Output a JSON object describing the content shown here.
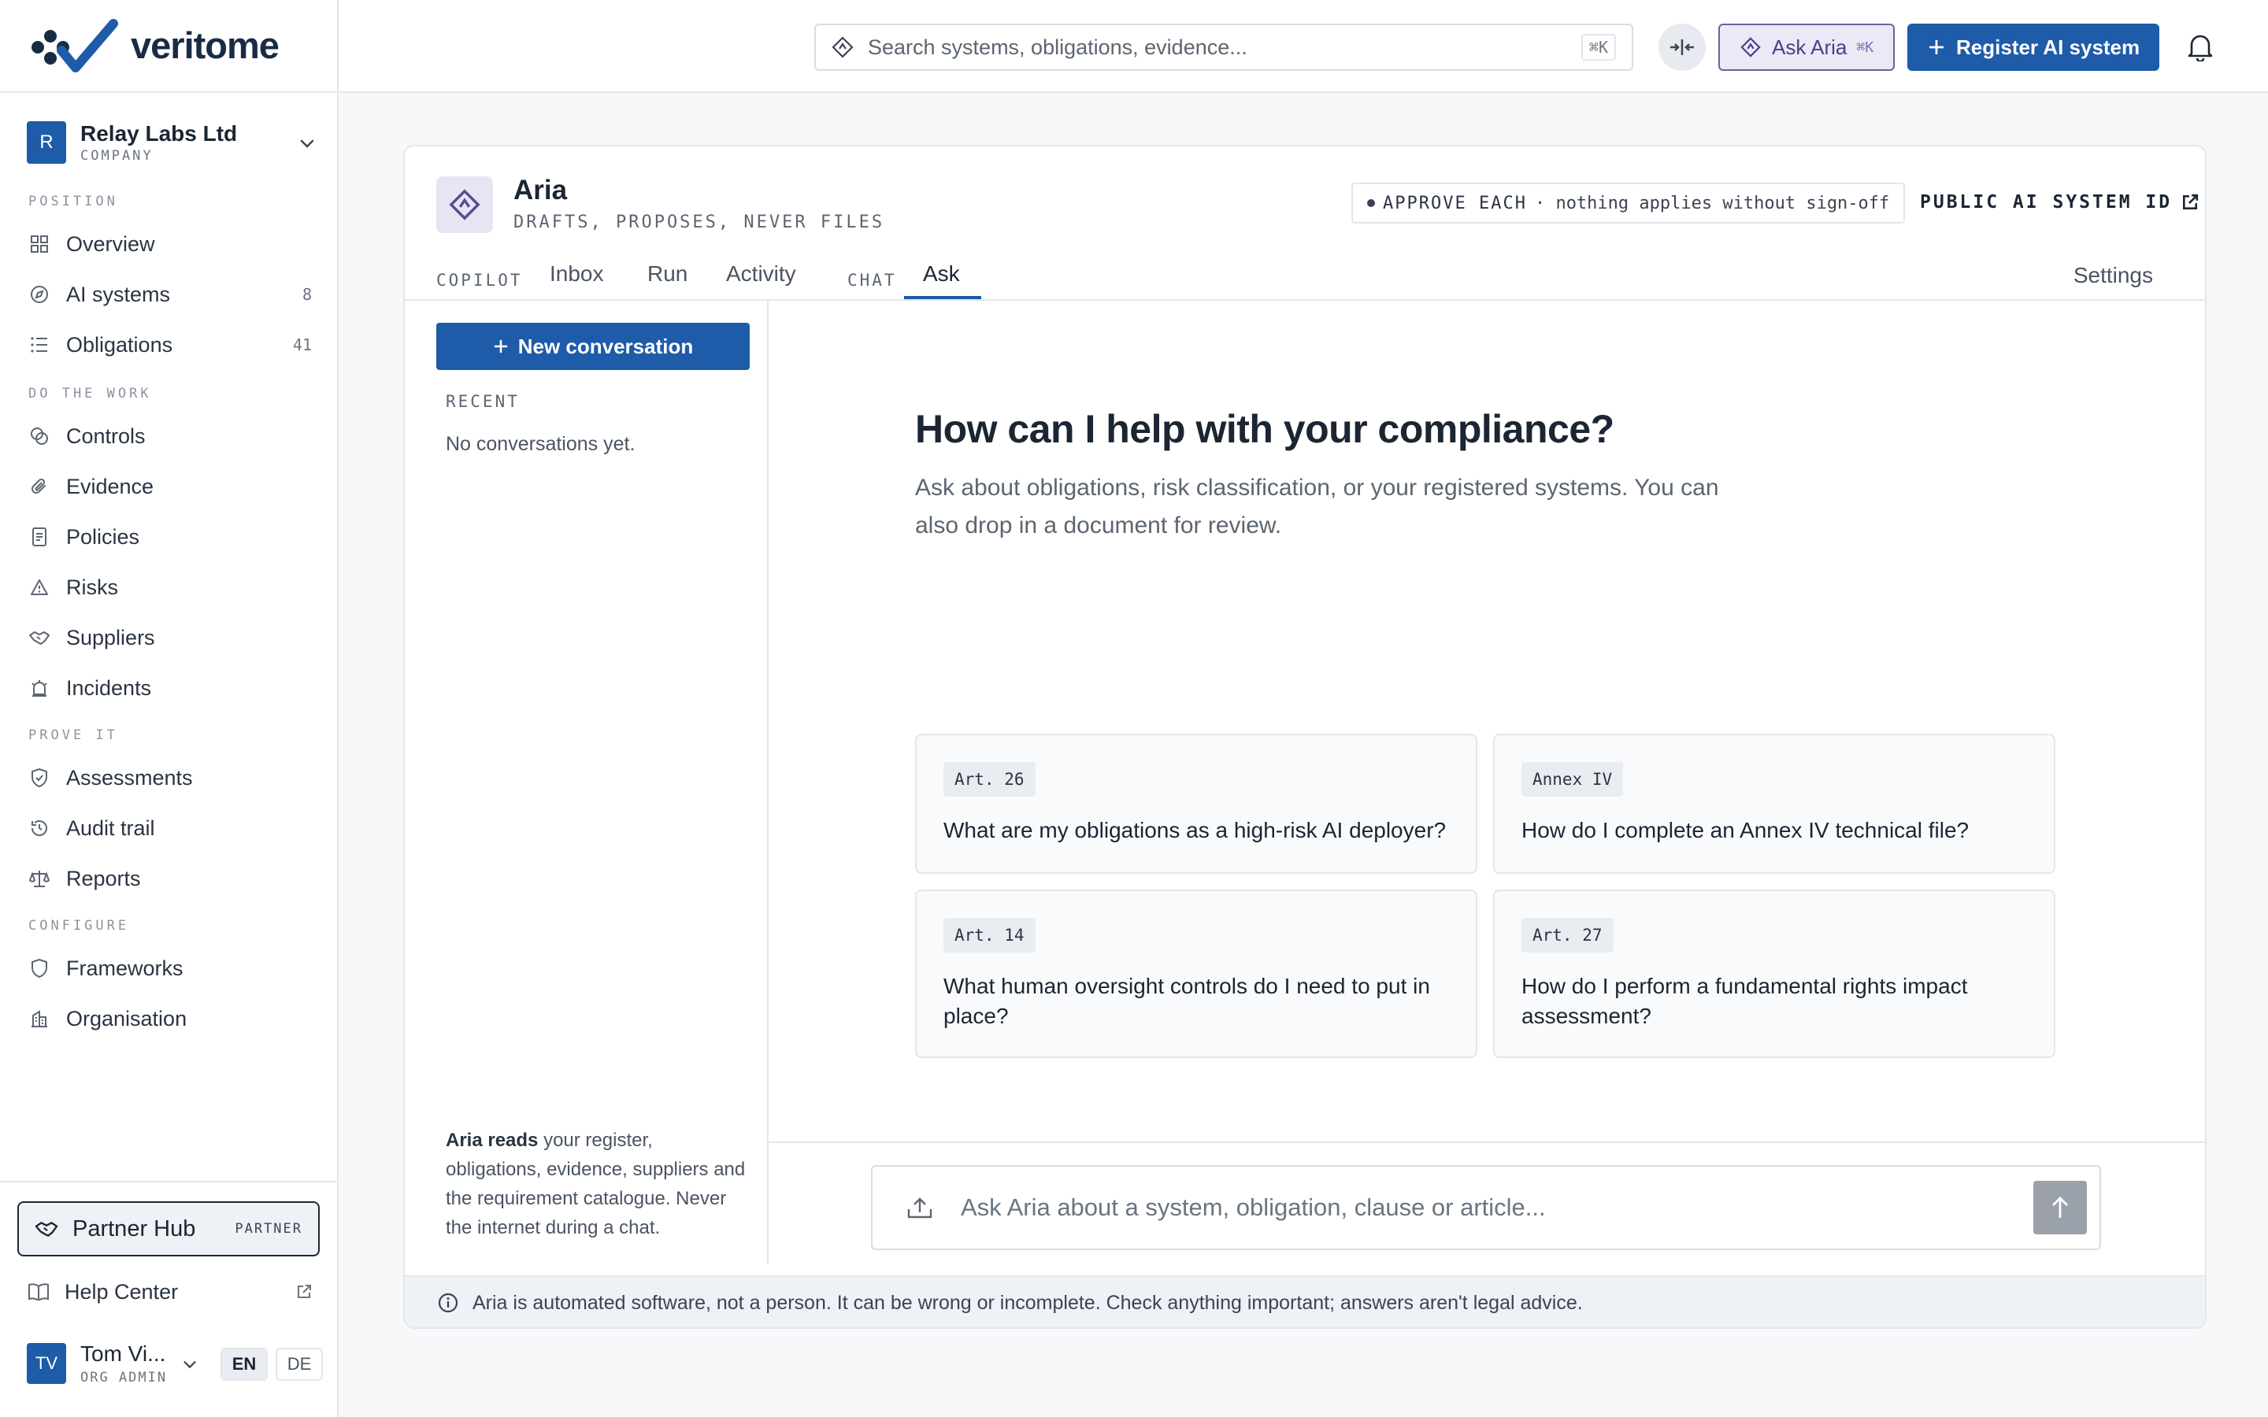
{
  "brand": {
    "name": "veritome"
  },
  "org": {
    "avatar": "R",
    "name": "Relay Labs Ltd",
    "role": "COMPANY"
  },
  "nav": {
    "sections": {
      "position": "POSITION",
      "do_the_work": "DO THE WORK",
      "prove_it": "PROVE IT",
      "configure": "CONFIGURE"
    },
    "items": [
      {
        "label": "Overview",
        "icon": "grid-icon"
      },
      {
        "label": "AI systems",
        "icon": "compass-icon",
        "count": "8"
      },
      {
        "label": "Obligations",
        "icon": "list-icon",
        "count": "41"
      },
      {
        "label": "Controls",
        "icon": "controls-icon"
      },
      {
        "label": "Evidence",
        "icon": "paperclip-icon"
      },
      {
        "label": "Policies",
        "icon": "document-icon"
      },
      {
        "label": "Risks",
        "icon": "warning-icon"
      },
      {
        "label": "Suppliers",
        "icon": "handshake-icon"
      },
      {
        "label": "Incidents",
        "icon": "alarm-icon"
      },
      {
        "label": "Assessments",
        "icon": "shield-check-icon"
      },
      {
        "label": "Audit trail",
        "icon": "history-icon"
      },
      {
        "label": "Reports",
        "icon": "scale-icon"
      },
      {
        "label": "Frameworks",
        "icon": "shield-icon"
      },
      {
        "label": "Organisation",
        "icon": "building-icon"
      }
    ]
  },
  "partner_hub": {
    "label": "Partner Hub",
    "badge": "PARTNER"
  },
  "help_center": {
    "label": "Help Center"
  },
  "user": {
    "initials": "TV",
    "name": "Tom Vi...",
    "role": "ORG ADMIN"
  },
  "languages": [
    "EN",
    "DE"
  ],
  "topbar": {
    "search_placeholder": "Search systems, obligations, evidence...",
    "search_shortcut": "⌘K",
    "ask_aria_label": "Ask Aria",
    "ask_aria_shortcut": "⌘K",
    "register_label": "Register AI system"
  },
  "panel": {
    "title": "Aria",
    "subtitle": "DRAFTS, PROPOSES, NEVER FILES",
    "approve_badge_strong": "APPROVE EACH",
    "approve_badge_rest": "· nothing applies without sign-off",
    "public_id_label": "PUBLIC AI SYSTEM ID",
    "tabs": {
      "copilot_group": "COPILOT",
      "inbox": "Inbox",
      "run": "Run",
      "activity": "Activity",
      "chat_group": "CHAT",
      "ask": "Ask",
      "settings": "Settings"
    },
    "new_conversation": "New conversation",
    "recent_label": "RECENT",
    "no_conversations": "No conversations yet.",
    "aria_reads_strong": "Aria reads",
    "aria_reads_rest": " your register, obligations, evidence, suppliers and the requirement catalogue. Never the internet during a chat.",
    "welcome_title": "How can I help with your compliance?",
    "welcome_desc": "Ask about obligations, risk classification, or your registered systems. You can also drop in a document for review.",
    "suggestions": [
      {
        "tag": "Art. 26",
        "question": "What are my obligations as a high-risk AI deployer?"
      },
      {
        "tag": "Annex IV",
        "question": "How do I complete an Annex IV technical file?"
      },
      {
        "tag": "Art. 14",
        "question": "What human oversight controls do I need to put in place?"
      },
      {
        "tag": "Art. 27",
        "question": "How do I perform a fundamental rights impact assessment?"
      }
    ],
    "composer_placeholder": "Ask Aria about a system, obligation, clause or article...",
    "disclaimer": "Aria is automated software, not a person. It can be wrong or incomplete. Check anything important; answers aren't legal advice."
  }
}
